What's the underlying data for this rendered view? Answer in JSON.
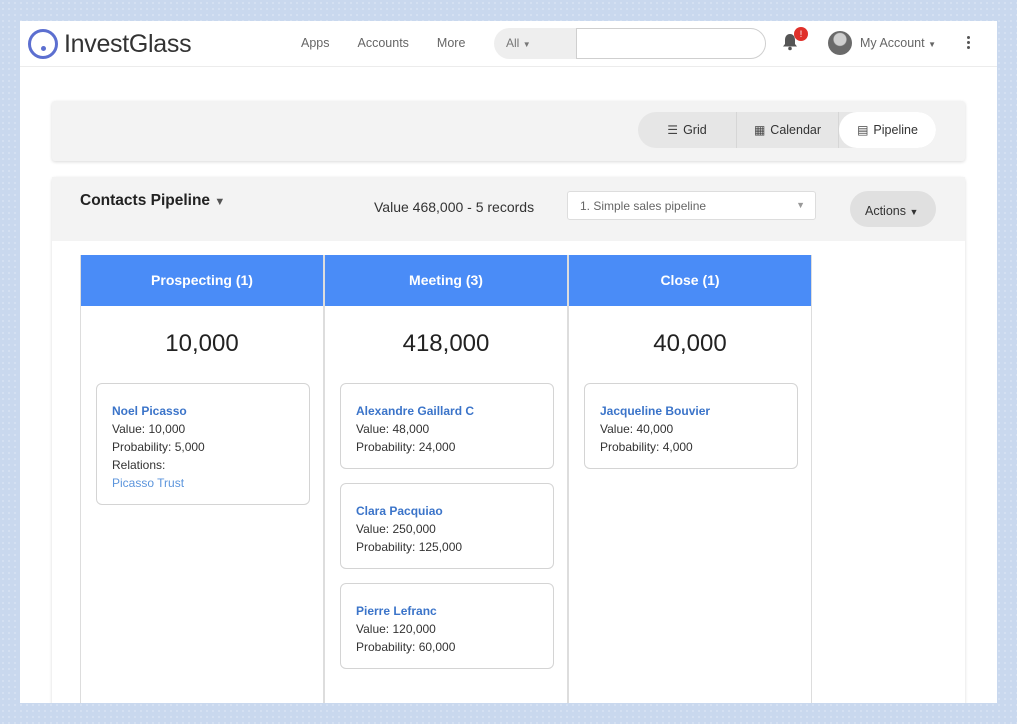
{
  "app": {
    "logo_text": "InvestGlass"
  },
  "nav": {
    "links": [
      "Apps",
      "Accounts",
      "More"
    ],
    "search_scope": "All",
    "search_value": "",
    "notification_count": "!",
    "account_label": "My Account"
  },
  "views": {
    "buttons": [
      {
        "label": "Grid",
        "icon": "list-icon"
      },
      {
        "label": "Calendar",
        "icon": "calendar-icon"
      },
      {
        "label": "Pipeline",
        "icon": "pipeline-icon",
        "active": true
      }
    ]
  },
  "pipeline": {
    "title": "Contacts Pipeline",
    "summary": "Value 468,000 - 5 records",
    "selected_pipeline": "1. Simple sales pipeline",
    "actions_label": "Actions",
    "header_color": "#4a8cf7",
    "columns": [
      {
        "title": "Prospecting (1)",
        "total": "10,000",
        "cards": [
          {
            "name": "Noel Picasso",
            "value": "Value: 10,000",
            "probability": "Probability: 5,000",
            "relations_label": "Relations:",
            "relation": "Picasso Trust"
          }
        ]
      },
      {
        "title": "Meeting (3)",
        "total": "418,000",
        "cards": [
          {
            "name": "Alexandre Gaillard C",
            "value": "Value: 48,000",
            "probability": "Probability: 24,000"
          },
          {
            "name": "Clara Pacquiao",
            "value": "Value: 250,000",
            "probability": "Probability: 125,000"
          },
          {
            "name": "Pierre Lefranc",
            "value": "Value: 120,000",
            "probability": "Probability: 60,000"
          }
        ]
      },
      {
        "title": "Close (1)",
        "total": "40,000",
        "cards": [
          {
            "name": "Jacqueline Bouvier",
            "value": "Value: 40,000",
            "probability": "Probability: 4,000"
          }
        ]
      }
    ]
  }
}
